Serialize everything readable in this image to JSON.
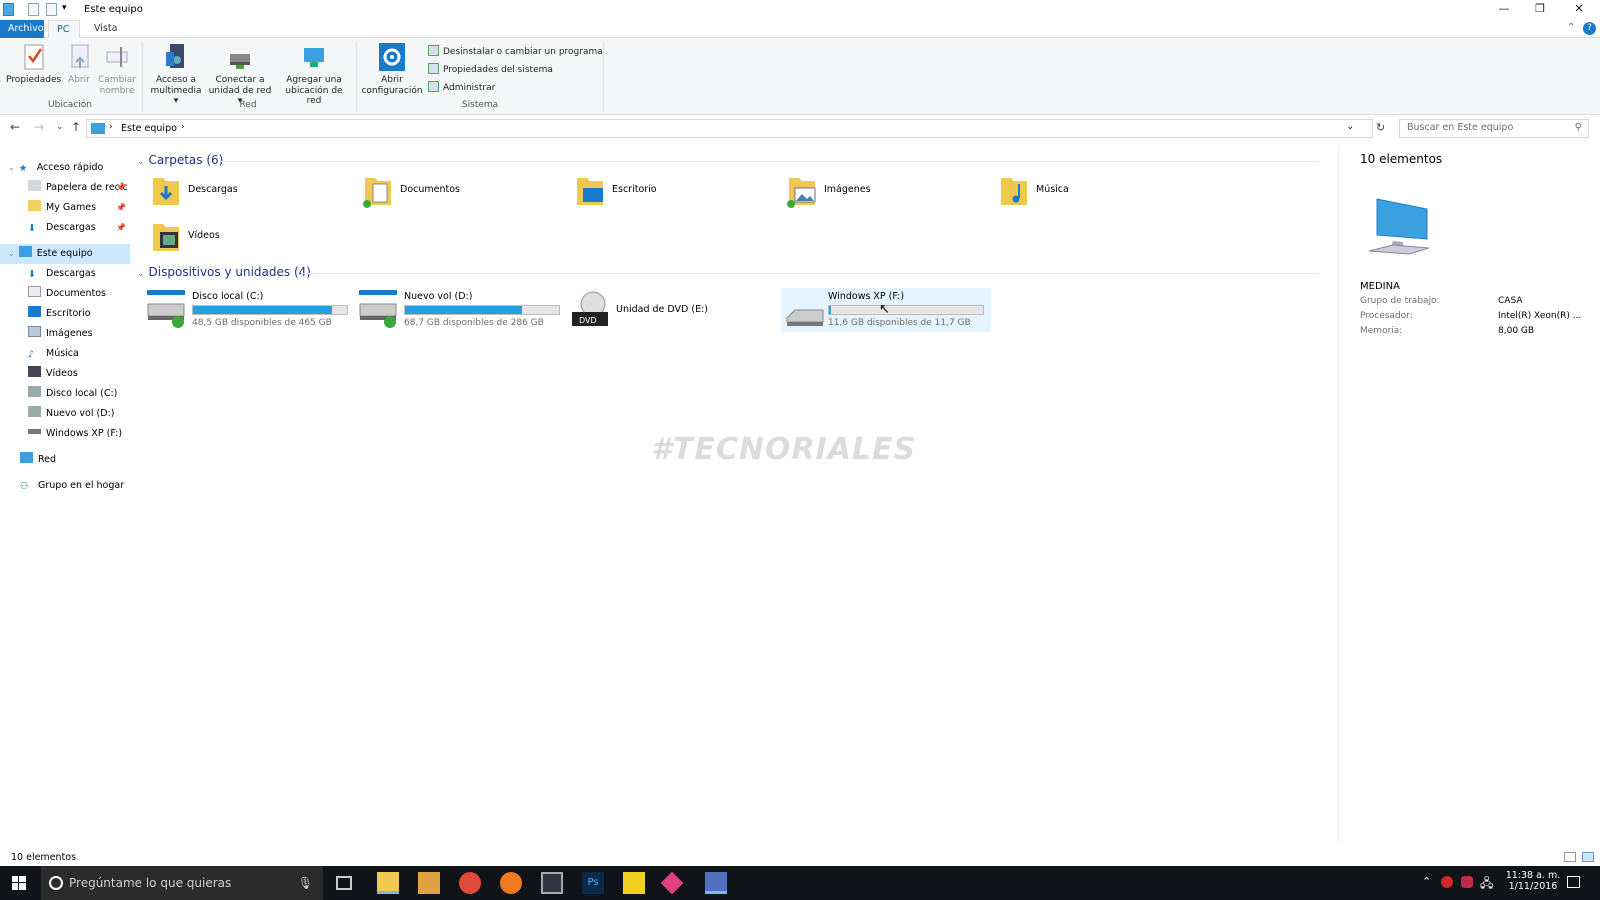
{
  "window": {
    "title": "Este equipo"
  },
  "ribbon": {
    "tabs": [
      "Archivo",
      "PC",
      "Vista"
    ],
    "buttons": {
      "propiedades": "Propiedades",
      "abrir": "Abrir",
      "cambiar": "Cambiar",
      "nombre": "nombre",
      "acceso_1": "Acceso a",
      "acceso_2": "multimedia",
      "conectar_1": "Conectar a",
      "conectar_2": "unidad de red",
      "agregar_1": "Agregar una",
      "agregar_2": "ubicación de red",
      "abrir_conf_1": "Abrir",
      "abrir_conf_2": "configuración",
      "desinstalar": "Desinstalar o cambiar un programa",
      "prop_sistema": "Propiedades del sistema",
      "administrar": "Administrar"
    },
    "groups": {
      "ubicacion": "Ubicación",
      "red": "Red",
      "sistema": "Sistema"
    }
  },
  "address": {
    "crumb": "Este equipo",
    "search_placeholder": "Buscar en Este equipo"
  },
  "sidebar": {
    "quick": "Acceso rápido",
    "quick_items": [
      "Papelera de recic",
      "My Games",
      "Descargas"
    ],
    "pc": "Este equipo",
    "pc_items": [
      "Descargas",
      "Documentos",
      "Escritorio",
      "Imágenes",
      "Música",
      "Vídeos",
      "Disco local (C:)",
      "Nuevo vol (D:)",
      "Windows XP (F:)"
    ],
    "red": "Red",
    "hogar": "Grupo en el hogar"
  },
  "content": {
    "folders_header": "Carpetas (6)",
    "folders": [
      "Descargas",
      "Documentos",
      "Escritorio",
      "Imágenes",
      "Música",
      "Vídeos"
    ],
    "devices_header": "Dispositivos y unidades (4)",
    "drives": [
      {
        "name": "Disco local (C:)",
        "free": "48,5 GB disponibles de 465 GB",
        "used_fraction": 0.9
      },
      {
        "name": "Nuevo vol (D:)",
        "free": "68,7 GB disponibles de 286 GB",
        "used_fraction": 0.76
      },
      {
        "name": "Unidad de DVD (E:)"
      },
      {
        "name": "Windows XP (F:)",
        "free": "11,6 GB disponibles de 11,7 GB",
        "used_fraction": 0.01
      }
    ],
    "watermark": "#TECNORIALES"
  },
  "details": {
    "count": "10 elementos",
    "computer_name": "MEDINA",
    "grupo_k": "Grupo de trabajo:",
    "grupo_v": "CASA",
    "proc_k": "Procesador:",
    "proc_v": "Intel(R) Xeon(R) ...",
    "mem_k": "Memoria:",
    "mem_v": "8,00 GB"
  },
  "status": {
    "count": "10 elementos"
  },
  "taskbar": {
    "search_placeholder": "Pregúntame lo que quieras",
    "time": "11:38 a. m.",
    "date": "1/11/2016"
  },
  "colors": {
    "accent": "#1979ca",
    "bar_fill": "#26a0da",
    "selection": "#cce8ff"
  }
}
